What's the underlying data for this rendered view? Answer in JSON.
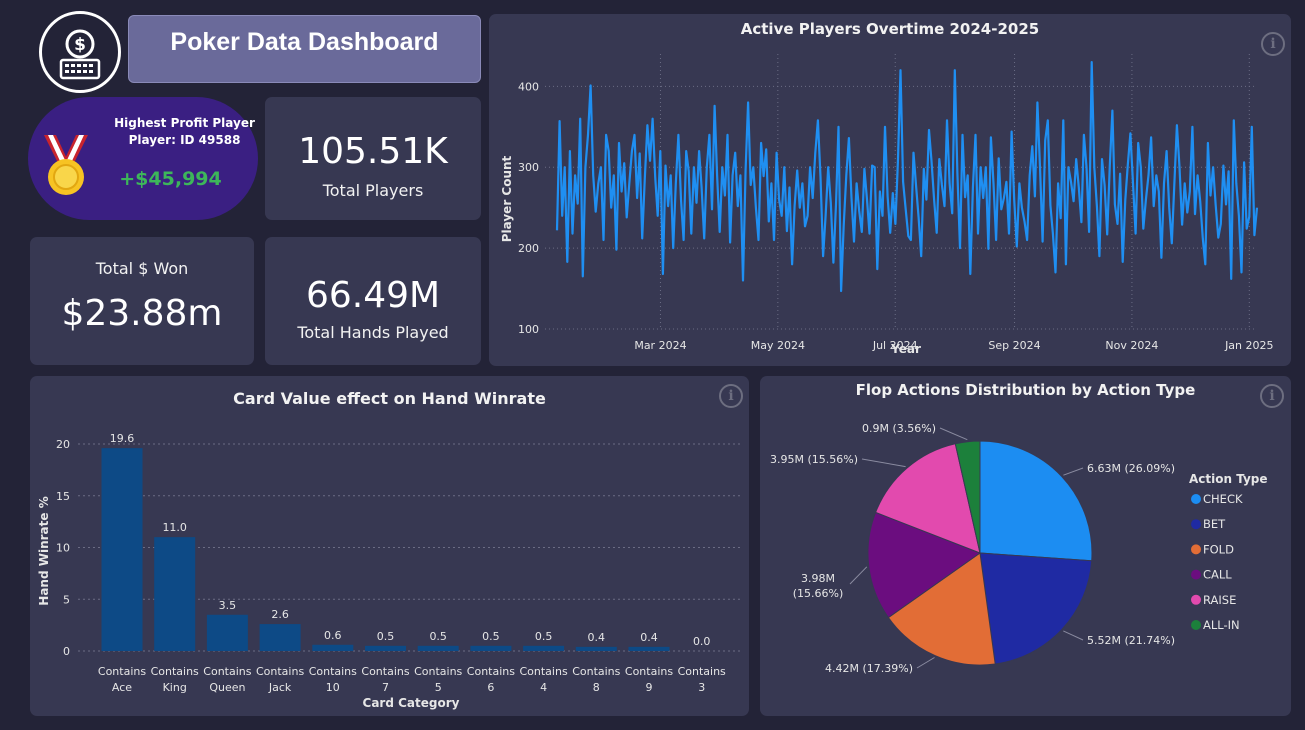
{
  "header": {
    "title": "Poker Data Dashboard",
    "logo_icon": "dollar-keyboard-icon"
  },
  "top_player": {
    "title": "Highest Profit Player",
    "player": "Player: ID 49588",
    "profit": "+$45,994",
    "icon": "medal-icon",
    "profit_color": "#3db65a"
  },
  "kpis": {
    "total_players_value": "105.51K",
    "total_players_label": "Total Players",
    "total_won_label": "Total $ Won",
    "total_won_value": "$23.88m",
    "total_hands_value": "66.49M",
    "total_hands_label": "Total Hands Played"
  },
  "colors": {
    "background": "#232337",
    "card": "#373852",
    "line": "#1f8ff2",
    "bar": "#0d4a86",
    "title_box": "#6a6a9a"
  },
  "chart_data": [
    {
      "type": "line",
      "title": "Active Players Overtime 2024-2025",
      "xlabel": "Year",
      "ylabel": "Player Count",
      "ylim": [
        100,
        440
      ],
      "yticks": [
        100,
        200,
        300,
        400
      ],
      "xticks": [
        "Mar 2024",
        "May 2024",
        "Jul 2024",
        "Sep 2024",
        "Nov 2024",
        "Jan 2025"
      ],
      "grid": true,
      "series": [
        {
          "x_start": "2024-01-01",
          "x_end": "2025-01-05",
          "values": [
            222,
            357,
            240,
            300,
            183,
            320,
            218,
            290,
            255,
            360,
            165,
            300,
            340,
            401,
            290,
            245,
            280,
            300,
            210,
            340,
            320,
            250,
            290,
            198,
            330,
            270,
            305,
            238,
            280,
            320,
            340,
            262,
            317,
            212,
            286,
            352,
            308,
            360,
            288,
            240,
            320,
            168,
            302,
            252,
            290,
            200,
            280,
            340,
            260,
            210,
            320,
            295,
            218,
            300,
            256,
            320,
            275,
            212,
            300,
            340,
            248,
            376,
            290,
            220,
            300,
            265,
            340,
            207,
            290,
            318,
            252,
            290,
            160,
            297,
            380,
            278,
            300,
            250,
            210,
            330,
            289,
            322,
            233,
            280,
            210,
            318,
            260,
            240,
            300,
            221,
            275,
            180,
            252,
            296,
            250,
            280,
            227,
            240,
            300,
            262,
            318,
            358,
            288,
            190,
            240,
            300,
            256,
            182,
            254,
            350,
            147,
            228,
            290,
            336,
            262,
            208,
            280,
            246,
            220,
            298,
            260,
            218,
            302,
            300,
            174,
            270,
            240,
            350,
            264,
            219,
            268,
            230,
            310,
            420,
            282,
            248,
            215,
            210,
            318,
            278,
            238,
            190,
            298,
            260,
            346,
            308,
            260,
            219,
            310,
            278,
            252,
            358,
            280,
            243,
            420,
            292,
            200,
            340,
            263,
            290,
            168,
            275,
            340,
            218,
            300,
            262,
            300,
            199,
            337,
            280,
            210,
            311,
            248,
            262,
            282,
            218,
            344,
            260,
            202,
            280,
            250,
            233,
            210,
            290,
            326,
            264,
            380,
            300,
            208,
            333,
            358,
            253,
            218,
            170,
            280,
            237,
            358,
            180,
            300,
            282,
            258,
            310,
            275,
            232,
            340,
            300,
            220,
            430,
            300,
            252,
            190,
            310,
            278,
            217,
            302,
            370,
            254,
            230,
            292,
            183,
            260,
            303,
            342,
            280,
            218,
            330,
            300,
            224,
            260,
            290,
            337,
            252,
            290,
            270,
            188,
            280,
            320,
            250,
            206,
            278,
            352,
            300,
            229,
            280,
            244,
            270,
            350,
            242,
            290,
            258,
            212,
            180,
            330,
            265,
            300,
            253,
            213,
            230,
            302,
            254,
            295,
            162,
            358,
            280,
            240,
            170,
            306,
            224,
            239,
            350,
            216,
            250
          ]
        }
      ]
    },
    {
      "type": "bar",
      "title": "Card Value effect on Hand Winrate",
      "xlabel": "Card Category",
      "ylabel": "Hand Winrate %",
      "ylim": [
        0,
        20
      ],
      "yticks": [
        0,
        5,
        10,
        15,
        20
      ],
      "grid": true,
      "categories": [
        [
          "Contains",
          "Ace"
        ],
        [
          "Contains",
          "King"
        ],
        [
          "Contains",
          "Queen"
        ],
        [
          "Contains",
          "Jack"
        ],
        [
          "Contains",
          "10"
        ],
        [
          "Contains",
          "7"
        ],
        [
          "Contains",
          "5"
        ],
        [
          "Contains",
          "6"
        ],
        [
          "Contains",
          "4"
        ],
        [
          "Contains",
          "8"
        ],
        [
          "Contains",
          "9"
        ],
        [
          "Contains",
          "3"
        ]
      ],
      "values": [
        19.6,
        11.0,
        3.5,
        2.6,
        0.6,
        0.5,
        0.5,
        0.5,
        0.5,
        0.4,
        0.4,
        0.0
      ],
      "value_labels": [
        "19.6",
        "11.0",
        "3.5",
        "2.6",
        "0.6",
        "0.5",
        "0.5",
        "0.5",
        "0.5",
        "0.4",
        "0.4",
        "0.0"
      ]
    },
    {
      "type": "pie",
      "title": "Flop Actions Distribution by Action Type",
      "legend_title": "Action Type",
      "legend_position": "right",
      "slices": [
        {
          "name": "CHECK",
          "value": 6.63,
          "label": "6.63M (26.09%)",
          "color": "#1c8df2"
        },
        {
          "name": "BET",
          "value": 5.52,
          "label": "5.52M (21.74%)",
          "color": "#1f2aa3"
        },
        {
          "name": "FOLD",
          "value": 4.42,
          "label": "4.42M (17.39%)",
          "color": "#e26d36"
        },
        {
          "name": "CALL",
          "value": 3.98,
          "label": "3.98M (15.66%)",
          "color": "#6b0d7f"
        },
        {
          "name": "RAISE",
          "value": 3.95,
          "label": "3.95M (15.56%)",
          "color": "#e24aae"
        },
        {
          "name": "ALL-IN",
          "value": 0.9,
          "label": "0.9M (3.56%)",
          "color": "#1c803b"
        }
      ]
    }
  ]
}
